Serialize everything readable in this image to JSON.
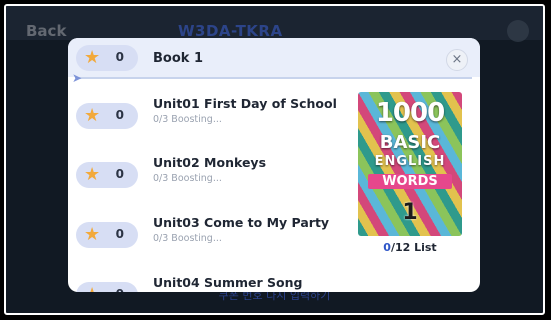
{
  "background": {
    "back_label": "Back",
    "room_code": "W3DA-TKRA",
    "footer_text": "쿠폰 번호 다시 입력하기"
  },
  "modal": {
    "book_title": "Book 1",
    "book_stars": "0",
    "close_glyph": "×",
    "units": [
      {
        "title": "Unit01 First Day of School",
        "status": "0/3 Boosting...",
        "stars": "0"
      },
      {
        "title": "Unit02 Monkeys",
        "status": "0/3 Boosting...",
        "stars": "0"
      },
      {
        "title": "Unit03 Come to My Party",
        "status": "0/3 Boosting...",
        "stars": "0"
      },
      {
        "title": "Unit04 Summer Song",
        "status": "",
        "stars": "0"
      }
    ],
    "cover": {
      "line1": "1000",
      "line2": "BASIC",
      "line3": "ENGLISH",
      "line4": "WORDS",
      "volume": "1"
    },
    "progress_done": "0",
    "progress_rest": "/12 List"
  },
  "icons": {
    "star": "star-icon",
    "close": "close-icon",
    "rocket": "rocket-icon"
  }
}
